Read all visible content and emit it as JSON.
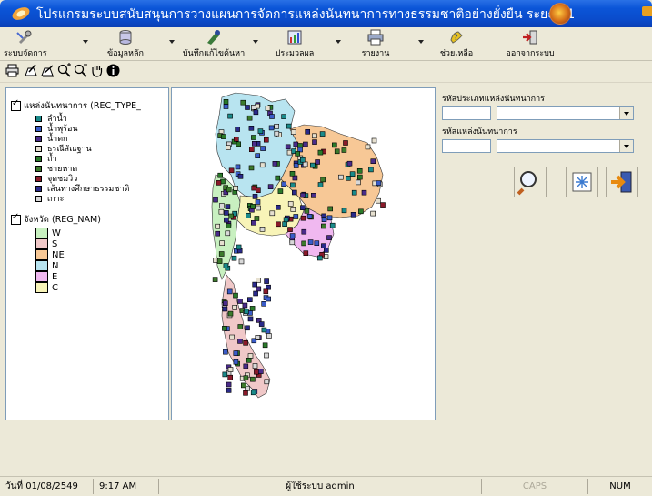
{
  "window": {
    "title": "โปรแกรมระบบสนับสนุนการวางแผนการจัดการแหล่งนันทนาการทางธรรมชาติอย่างยั่งยืน ระยะที่ 1"
  },
  "menu": {
    "items": [
      {
        "label": "ระบบจัดการ",
        "icon": "settings-tools-icon"
      },
      {
        "label": "ข้อมูลหลัก",
        "icon": "database-icon"
      },
      {
        "label": "บันทึกแก้ไขค้นหา",
        "icon": "edit-search-icon"
      },
      {
        "label": "ประมวลผล",
        "icon": "process-chart-icon"
      },
      {
        "label": "รายงาน",
        "icon": "printer-report-icon"
      },
      {
        "label": "ช่วยเหลือ",
        "icon": "help-icon"
      },
      {
        "label": "ออกจากระบบ",
        "icon": "exit-icon"
      }
    ]
  },
  "map_tools": [
    {
      "icon": "print-icon"
    },
    {
      "icon": "layer-add-icon"
    },
    {
      "icon": "layer-edit-icon"
    },
    {
      "icon": "zoom-in-icon"
    },
    {
      "icon": "zoom-out-icon"
    },
    {
      "icon": "pan-hand-icon"
    },
    {
      "icon": "info-icon"
    }
  ],
  "legend": {
    "layer1": {
      "title": "แหล่งนันทนาการ (REC_TYPE_",
      "items": [
        {
          "label": "ลำน้ำ",
          "color": "#1a8a8a"
        },
        {
          "label": "น้ำพุร้อน",
          "color": "#3a5cc8"
        },
        {
          "label": "น้ำตก",
          "color": "#4a2c8a"
        },
        {
          "label": "ธรณีสัณฐาน",
          "color": "#e6e0d0"
        },
        {
          "label": "ถ้ำ",
          "color": "#2a7a2a"
        },
        {
          "label": "ชายหาด",
          "color": "#3c7a2c"
        },
        {
          "label": "จุดชมวิว",
          "color": "#8a1a2a"
        },
        {
          "label": "เส้นทางศึกษาธรรมชาติ",
          "color": "#2a2a8a"
        },
        {
          "label": "เกาะ",
          "color": "#d8d8d8"
        }
      ]
    },
    "layer2": {
      "title": "จังหวัด (REG_NAM)",
      "items": [
        {
          "label": "W",
          "color": "#c8f0c0"
        },
        {
          "label": "S",
          "color": "#f0c8c8"
        },
        {
          "label": "NE",
          "color": "#f7c896"
        },
        {
          "label": "N",
          "color": "#b8e4f0"
        },
        {
          "label": "E",
          "color": "#f0b8f0"
        },
        {
          "label": "C",
          "color": "#f8f4b8"
        }
      ]
    }
  },
  "filters": {
    "rec_type_label": "รหัสประเภทแหล่งนันทนาการ",
    "rec_site_label": "รหัสแหล่งนันทนาการ",
    "rec_type_code": "",
    "rec_type_selected": "",
    "rec_site_code": "",
    "rec_site_selected": ""
  },
  "actions": [
    {
      "icon": "search-magnifier-icon"
    },
    {
      "icon": "clear-refresh-icon"
    },
    {
      "icon": "exit-door-icon"
    }
  ],
  "status": {
    "date": "วันที่ 01/08/2549",
    "time": "9:17 AM",
    "user": "ผู้ใช้ระบบ admin",
    "caps": "CAPS",
    "num": "NUM"
  }
}
